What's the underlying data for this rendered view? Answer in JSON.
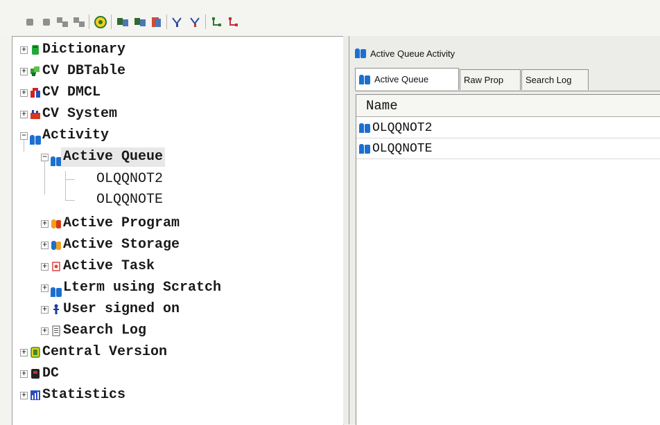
{
  "toolbar": {
    "buttons": [
      "stop-icon",
      "pause-icon",
      "connect-icon",
      "disconnect-icon",
      "refresh-icon",
      "copy-icon",
      "copy-all-icon",
      "properties-icon",
      "filter-icon",
      "filter-clear-icon",
      "tree-expand-icon",
      "tree-collapse-icon"
    ]
  },
  "tree": {
    "root_items": [
      {
        "label": "Dictionary",
        "icon": "dictionary-icon"
      },
      {
        "label": "CV DBTable",
        "icon": "dbtable-icon"
      },
      {
        "label": "CV DMCL",
        "icon": "dmcl-icon"
      },
      {
        "label": "CV System",
        "icon": "system-icon"
      },
      {
        "label": "Activity",
        "icon": "activity-icon"
      },
      {
        "label": "Central Version",
        "icon": "central-version-icon"
      },
      {
        "label": "DC",
        "icon": "dc-icon"
      },
      {
        "label": "Statistics",
        "icon": "statistics-icon"
      }
    ],
    "activity_children": [
      {
        "label": "Active Queue",
        "icon": "queue-icon"
      },
      {
        "label": "Active Program",
        "icon": "program-icon"
      },
      {
        "label": "Active Storage",
        "icon": "storage-icon"
      },
      {
        "label": "Active Task",
        "icon": "task-icon"
      },
      {
        "label": "Lterm using Scratch",
        "icon": "lterm-icon"
      },
      {
        "label": "User signed on",
        "icon": "user-icon"
      },
      {
        "label": "Search Log",
        "icon": "log-icon"
      }
    ],
    "queue_leaves": [
      "OLQQNOT2",
      "OLQQNOTE"
    ]
  },
  "right_panel": {
    "title": "Active Queue  Activity",
    "tabs": [
      "Active Queue",
      "Raw Prop",
      "Search Log"
    ],
    "active_tab": "Active Queue",
    "column_header": "Name",
    "rows": [
      "OLQQNOT2",
      "OLQQNOTE"
    ]
  },
  "colors": {
    "accent_blue": "#1c6fd0",
    "selection": "#e8e8e8"
  }
}
